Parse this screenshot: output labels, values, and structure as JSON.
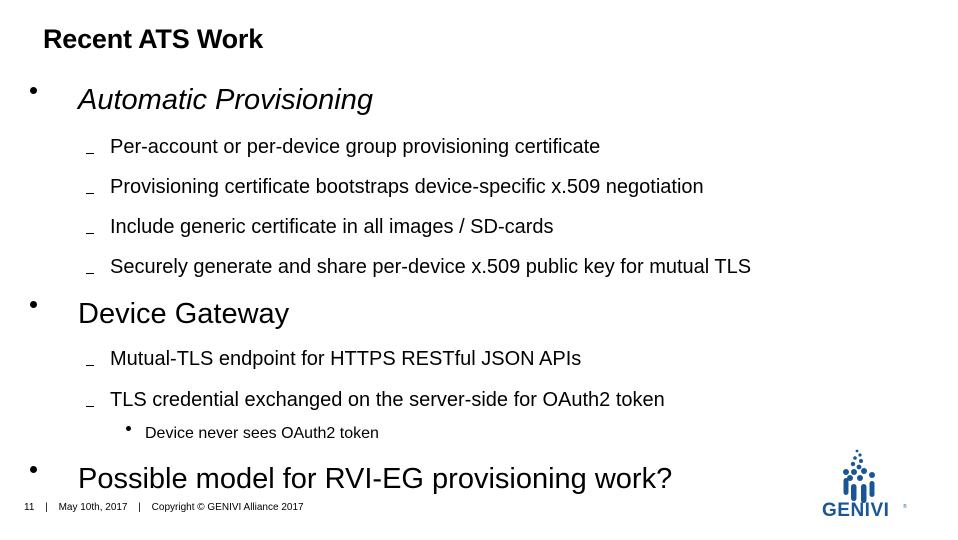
{
  "slide": {
    "title": "Recent ATS Work",
    "sections": [
      {
        "heading": "Automatic Provisioning",
        "items": [
          "Per-account or per-device group provisioning certificate",
          "Provisioning certificate bootstraps device-specific x.509 negotiation",
          "Include generic certificate in all images / SD-cards",
          "Securely generate and share per-device x.509 public key for mutual TLS"
        ]
      },
      {
        "heading": "Device Gateway",
        "items": [
          "Mutual-TLS endpoint for HTTPS RESTful JSON APIs",
          "TLS credential exchanged on the server-side for OAuth2 token"
        ],
        "subitems": [
          "Device never sees OAuth2 token"
        ]
      },
      {
        "heading": "Possible model for RVI-EG provisioning work?"
      }
    ]
  },
  "footer": {
    "page_number": "11",
    "separator": "|",
    "date": "May 10th, 2017",
    "copyright": "Copyright © GENIVI Alliance 2017"
  },
  "logo": {
    "name": "GENIVI",
    "registered_mark": "®",
    "color": "#1a5696"
  }
}
